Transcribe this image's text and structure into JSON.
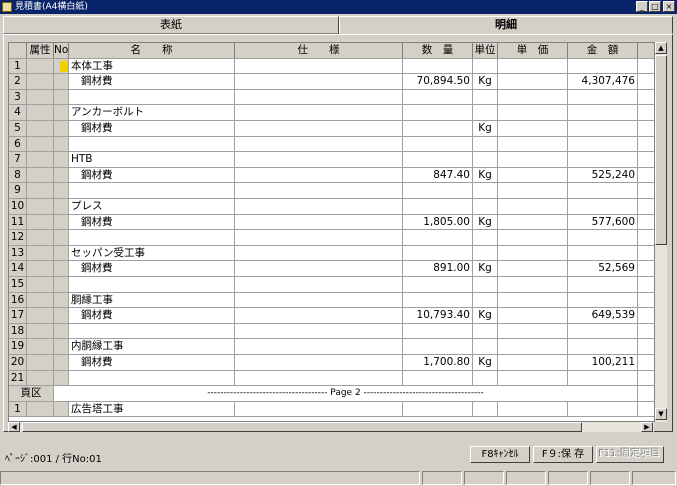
{
  "window": {
    "title": "見積書(A4横白紙)",
    "minimize": "_",
    "maximize": "□",
    "close": "×"
  },
  "tabs": [
    {
      "label": "表紙"
    },
    {
      "label": "明細"
    }
  ],
  "columns": {
    "no": "",
    "attr": "属性",
    "no2": "No",
    "name": "名　　称",
    "spec": "仕　　様",
    "qty": "数　量",
    "unit": "単位",
    "price": "単　価",
    "amount": "金　額"
  },
  "rows": [
    {
      "no": "1",
      "name": "本体工事",
      "qty": "",
      "unit": "",
      "amount": ""
    },
    {
      "no": "2",
      "name": "鋼材費",
      "qty": "70,894.50",
      "unit": "Kg",
      "amount": "4,307,476"
    },
    {
      "no": "3",
      "name": "",
      "qty": "",
      "unit": "",
      "amount": ""
    },
    {
      "no": "4",
      "name": "アンカーボルト",
      "qty": "",
      "unit": "",
      "amount": ""
    },
    {
      "no": "5",
      "name": "鋼材費",
      "qty": "",
      "unit": "Kg",
      "amount": ""
    },
    {
      "no": "6",
      "name": "",
      "qty": "",
      "unit": "",
      "amount": ""
    },
    {
      "no": "7",
      "name": "HTB",
      "qty": "",
      "unit": "",
      "amount": ""
    },
    {
      "no": "8",
      "name": "鋼材費",
      "qty": "847.40",
      "unit": "Kg",
      "amount": "525,240"
    },
    {
      "no": "9",
      "name": "",
      "qty": "",
      "unit": "",
      "amount": ""
    },
    {
      "no": "10",
      "name": "プレス",
      "qty": "",
      "unit": "",
      "amount": ""
    },
    {
      "no": "11",
      "name": "鋼材費",
      "qty": "1,805.00",
      "unit": "Kg",
      "amount": "577,600"
    },
    {
      "no": "12",
      "name": "",
      "qty": "",
      "unit": "",
      "amount": ""
    },
    {
      "no": "13",
      "name": "セッパン受工事",
      "qty": "",
      "unit": "",
      "amount": ""
    },
    {
      "no": "14",
      "name": "鋼材費",
      "qty": "891.00",
      "unit": "Kg",
      "amount": "52,569"
    },
    {
      "no": "15",
      "name": "",
      "qty": "",
      "unit": "",
      "amount": ""
    },
    {
      "no": "16",
      "name": "胴縁工事",
      "qty": "",
      "unit": "",
      "amount": ""
    },
    {
      "no": "17",
      "name": "鋼材費",
      "qty": "10,793.40",
      "unit": "Kg",
      "amount": "649,539"
    },
    {
      "no": "18",
      "name": "",
      "qty": "",
      "unit": "",
      "amount": ""
    },
    {
      "no": "19",
      "name": "内胴縁工事",
      "qty": "",
      "unit": "",
      "amount": ""
    },
    {
      "no": "20",
      "name": "鋼材費",
      "qty": "1,700.80",
      "unit": "Kg",
      "amount": "100,211"
    },
    {
      "no": "21",
      "name": "",
      "qty": "",
      "unit": "",
      "amount": ""
    }
  ],
  "page_break": {
    "label": "頁区",
    "text": "------------------------------------- Page 2 -------------------------------------"
  },
  "page2_row": {
    "no": "1",
    "name": "広告塔工事"
  },
  "footer": {
    "page_info": "ﾍﾟｰｼﾞ:001 / 行No:01",
    "f8": "F8ｷｬﾝｾﾙ",
    "f9": "F９:保 存",
    "f11": "F11:固定項目"
  }
}
